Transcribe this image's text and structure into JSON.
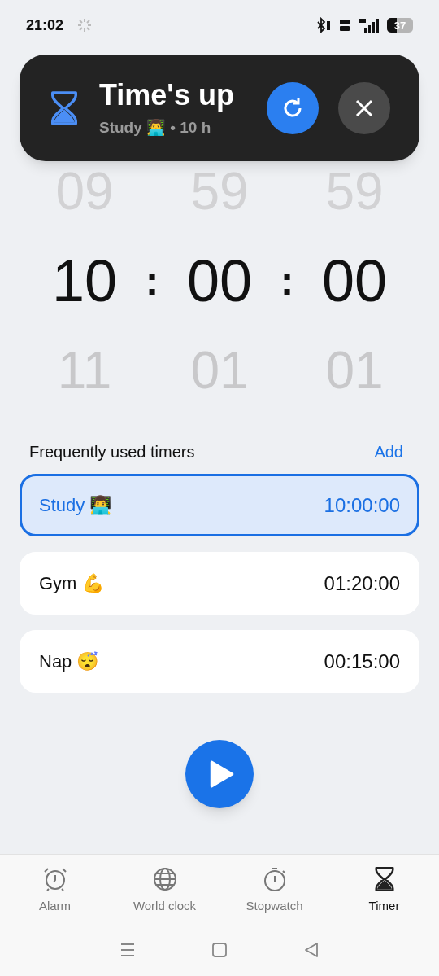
{
  "status_bar": {
    "time": "21:02",
    "battery": "37"
  },
  "notification": {
    "title": "Time's up",
    "subtitle": "Study 👨‍💻 • 10 h"
  },
  "picker": {
    "columns": [
      {
        "above": "09",
        "value": "10",
        "below": "11"
      },
      {
        "above": "59",
        "value": "00",
        "below": "01"
      },
      {
        "above": "59",
        "value": "00",
        "below": "01"
      }
    ],
    "separator": ":"
  },
  "presets": {
    "title": "Frequently used timers",
    "add": "Add",
    "items": [
      {
        "label": "Study 👨‍💻",
        "duration": "10:00:00",
        "selected": true
      },
      {
        "label": "Gym 💪",
        "duration": "01:20:00",
        "selected": false
      },
      {
        "label": "Nap 😴",
        "duration": "00:15:00",
        "selected": false
      }
    ]
  },
  "tabs": [
    {
      "label": "Alarm",
      "kind": "alarm",
      "selected": false
    },
    {
      "label": "World clock",
      "kind": "globe",
      "selected": false
    },
    {
      "label": "Stopwatch",
      "kind": "stopwatch",
      "selected": false
    },
    {
      "label": "Timer",
      "kind": "timer",
      "selected": true
    }
  ]
}
